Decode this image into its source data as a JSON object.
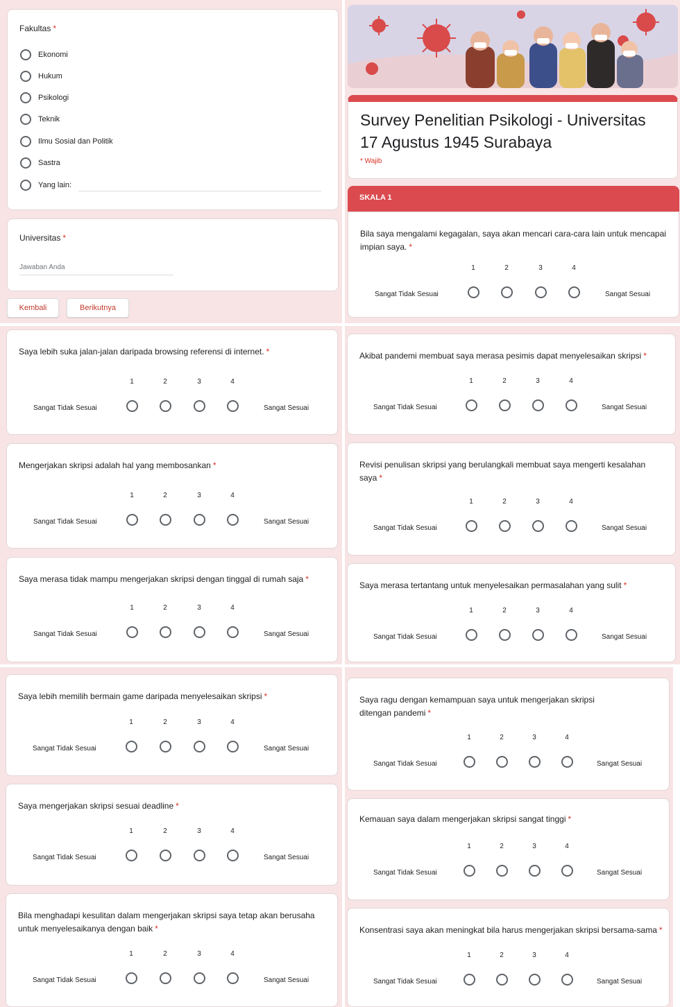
{
  "scale": {
    "points": [
      "1",
      "2",
      "3",
      "4"
    ],
    "min_label": "Sangat Tidak Sesuai",
    "max_label": "Sangat Sesuai"
  },
  "required_mark": "*",
  "faculty": {
    "title": "Fakultas",
    "options": [
      "Ekonomi",
      "Hukum",
      "Psikologi",
      "Teknik",
      "Ilmu Sosial dan Politik",
      "Sastra",
      "Yang lain:"
    ]
  },
  "university": {
    "title": "Universitas",
    "placeholder": "Jawaban Anda"
  },
  "nav": {
    "back_label": "Kembali",
    "next_label": "Berikutnya"
  },
  "form_header": {
    "title": "Survey Penelitian Psikologi - Universitas 17 Agustus 1945 Surabaya",
    "required_note": "* Wajib"
  },
  "section": {
    "title": "SKALA 1"
  },
  "questions": [
    "Bila saya mengalami kegagalan, saya akan mencari cara-cara lain untuk mencapai impian saya.",
    "Saya lebih suka jalan-jalan daripada browsing referensi di internet.",
    "Mengerjakan skripsi adalah hal yang membosankan",
    "Saya merasa tidak mampu mengerjakan skripsi dengan tinggal di rumah saja",
    "Akibat pandemi membuat saya merasa pesimis dapat menyelesaikan skripsi",
    "Revisi penulisan skripsi yang berulangkali membuat saya mengerti kesalahan saya",
    "Saya merasa tertantang untuk menyelesaikan permasalahan yang sulit",
    "Saya lebih memilih bermain game daripada menyelesaikan skripsi",
    "Saya mengerjakan skripsi sesuai deadline",
    "Bila menghadapi kesulitan dalam mengerjakan skripsi saya tetap akan berusaha untuk menyelesaikanya dengan baik",
    "Saya ragu dengan kemampuan saya untuk mengerjakan skripsi ditengan pandemi",
    "Kemauan saya dalam mengerjakan skripsi sangat tinggi",
    "Konsentrasi saya akan meningkat bila harus mengerjakan skripsi bersama-sama"
  ],
  "colors": {
    "accent": "#db4a4f",
    "panel_bg": "#f8e4e5",
    "required": "#d93025"
  }
}
